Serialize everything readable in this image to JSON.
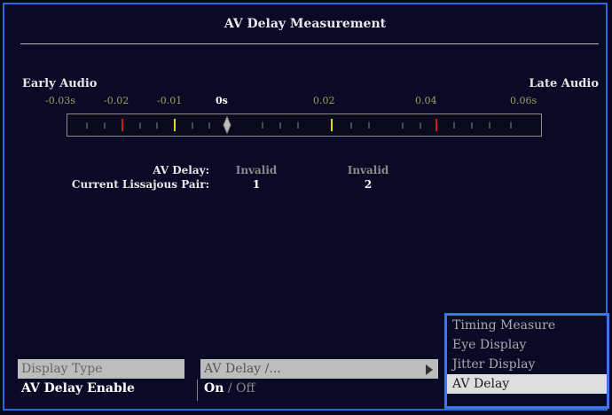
{
  "title": "AV Delay Measurement",
  "scale": {
    "early_label": "Early Audio",
    "late_label": "Late Audio",
    "tick_labels": [
      "-0.03s",
      "-0.02",
      "-0.01",
      "0s",
      "0.02",
      "0.04",
      "0.06s"
    ]
  },
  "measurement": {
    "av_delay_label": "AV Delay:",
    "av_delay_values": [
      "Invalid",
      "Invalid"
    ],
    "pair_label": "Current Lissajous Pair:",
    "pair_values": [
      "1",
      "2"
    ]
  },
  "menu": {
    "display_type_label": "Display Type",
    "display_type_value": "AV Delay /...",
    "enable_label": "AV Delay Enable",
    "enable_on": "On",
    "enable_sep": " / ",
    "enable_off": "Off"
  },
  "popup": {
    "items": [
      "Timing Measure",
      "Eye Display",
      "Jitter Display",
      "AV Delay"
    ],
    "selected": "AV Delay"
  },
  "colors": {
    "frame_border": "#2a6ad8",
    "tick_red": "#d01818",
    "tick_yellow": "#d8d820",
    "marker": "#bcbcbc"
  }
}
